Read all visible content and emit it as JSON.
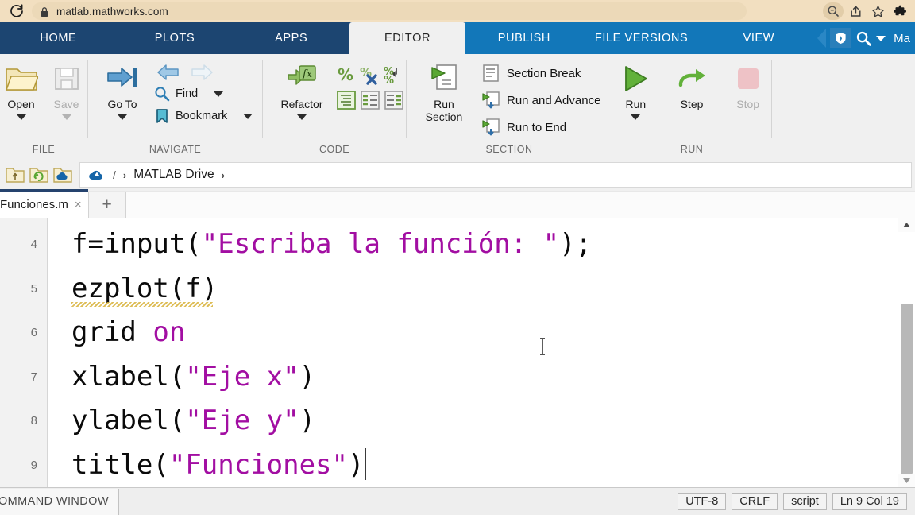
{
  "browser": {
    "reload_icon": "reload-icon",
    "lock_icon": "lock-icon",
    "url": "matlab.mathworks.com",
    "actions": [
      {
        "name": "zoom-indicator-icon",
        "glyph": "zoom"
      },
      {
        "name": "share-icon",
        "glyph": "share"
      },
      {
        "name": "bookmark-star-icon",
        "glyph": "star"
      },
      {
        "name": "extensions-puzzle-icon",
        "glyph": "puzzle"
      }
    ]
  },
  "toolstrip": {
    "left_tabs": [
      {
        "label": "HOME",
        "active": false
      },
      {
        "label": "PLOTS",
        "active": false
      },
      {
        "label": "APPS",
        "active": false
      }
    ],
    "editor_tab": {
      "label": "EDITOR",
      "active": true
    },
    "right_tabs": [
      {
        "label": "PUBLISH",
        "active": false
      },
      {
        "label": "FILE VERSIONS",
        "active": false
      },
      {
        "label": "VIEW",
        "active": false
      }
    ],
    "badge_icon": "shield-badge-icon",
    "search_icon": "search-icon",
    "caret_icon": "chevron-down-icon",
    "user_label": "Ma",
    "colors": {
      "left_tabstrip_bg": "#1c4571",
      "right_tabstrip_bg": "#1277b9",
      "active_tab_bg": "#f0f0f0"
    }
  },
  "ribbon": {
    "groups": [
      {
        "name": "FILE",
        "label": "FILE",
        "buttons": [
          {
            "label": "Open",
            "icon": "open-folder-icon",
            "dropdown": true,
            "disabled": false
          },
          {
            "label": "Save",
            "icon": "save-floppy-icon",
            "dropdown": true,
            "disabled": true
          }
        ]
      },
      {
        "name": "NAVIGATE",
        "label": "NAVIGATE",
        "buttons": [
          {
            "label": "Go To",
            "icon": "go-to-icon",
            "dropdown": true,
            "disabled": false
          }
        ],
        "nav_arrows": [
          {
            "name": "back-arrow-icon",
            "disabled": false
          },
          {
            "name": "forward-arrow-icon",
            "disabled": true
          }
        ],
        "small_items": [
          {
            "label": "Find",
            "icon": "find-magnifier-icon",
            "dropdown": true
          },
          {
            "label": "Bookmark",
            "icon": "bookmark-icon",
            "dropdown": true
          }
        ]
      },
      {
        "name": "CODE",
        "label": "CODE",
        "buttons": [
          {
            "label": "Refactor",
            "icon": "refactor-fx-icon",
            "dropdown": true,
            "disabled": false
          }
        ],
        "grid_icons": [
          {
            "name": "comment-icon"
          },
          {
            "name": "uncomment-icon"
          },
          {
            "name": "wrap-comment-icon"
          },
          {
            "name": "smart-indent-icon"
          },
          {
            "name": "increase-indent-icon"
          },
          {
            "name": "decrease-indent-icon"
          }
        ]
      },
      {
        "name": "SECTION",
        "label": "SECTION",
        "buttons": [
          {
            "label": "Run\nSection",
            "icon": "run-section-icon",
            "dropdown": false,
            "disabled": false
          }
        ],
        "small_items": [
          {
            "label": "Section Break",
            "icon": "section-break-icon"
          },
          {
            "label": "Run and Advance",
            "icon": "run-and-advance-icon"
          },
          {
            "label": "Run to End",
            "icon": "run-to-end-icon"
          }
        ]
      },
      {
        "name": "RUN",
        "label": "RUN",
        "buttons": [
          {
            "label": "Run",
            "icon": "run-play-icon",
            "dropdown": true,
            "disabled": false
          },
          {
            "label": "Step",
            "icon": "step-icon",
            "dropdown": false,
            "disabled": false
          },
          {
            "label": "Stop",
            "icon": "stop-icon",
            "dropdown": false,
            "disabled": true
          }
        ]
      }
    ]
  },
  "breadcrumb": {
    "tools": [
      {
        "name": "go-up-folder-icon"
      },
      {
        "name": "refresh-folder-icon"
      },
      {
        "name": "cloud-folder-icon"
      }
    ],
    "root_icon": "matlab-drive-cloud-icon",
    "separator": "/",
    "chevron": "›",
    "path_name": "MATLAB Drive",
    "trailing_chevron": "›"
  },
  "file_tabs": {
    "tabs": [
      {
        "name": "Funciones.m",
        "close": "×",
        "active": true
      }
    ],
    "new_tab_glyph": "+"
  },
  "editor": {
    "line_numbers": [
      "4",
      "5",
      "6",
      "7",
      "8",
      "9"
    ],
    "lines": [
      {
        "number": "4",
        "segments": [
          {
            "text": "f=input(",
            "type": "plain"
          },
          {
            "text": "\"Escriba la función: \"",
            "type": "string"
          },
          {
            "text": ");",
            "type": "plain"
          }
        ],
        "warning_underline": false
      },
      {
        "number": "5",
        "segments": [
          {
            "text": "ezplot(f)",
            "type": "plain"
          }
        ],
        "warning_underline": true
      },
      {
        "number": "6",
        "segments": [
          {
            "text": "grid ",
            "type": "plain"
          },
          {
            "text": "on",
            "type": "keyword"
          }
        ],
        "warning_underline": false
      },
      {
        "number": "7",
        "segments": [
          {
            "text": "xlabel(",
            "type": "plain"
          },
          {
            "text": "\"Eje x\"",
            "type": "string"
          },
          {
            "text": ")",
            "type": "plain"
          }
        ],
        "warning_underline": false
      },
      {
        "number": "8",
        "segments": [
          {
            "text": "ylabel(",
            "type": "plain"
          },
          {
            "text": "\"Eje y\"",
            "type": "string"
          },
          {
            "text": ")",
            "type": "plain"
          }
        ],
        "warning_underline": false
      },
      {
        "number": "9",
        "segments": [
          {
            "text": "title(",
            "type": "plain"
          },
          {
            "text": "\"Funciones\"",
            "type": "string"
          },
          {
            "text": ")",
            "type": "plain"
          }
        ],
        "warning_underline": false,
        "caret_at_end": true
      }
    ],
    "colors": {
      "string": "#a20ea2",
      "keyword": "#a20ea2",
      "plain": "#0a0a0a",
      "gutter_bg": "#f2f2f2",
      "background": "#ffffff"
    }
  },
  "statusbar": {
    "panel_label": "OMMAND WINDOW",
    "chips": [
      "UTF-8",
      "CRLF",
      "script",
      "Ln 9 Col 19"
    ]
  }
}
